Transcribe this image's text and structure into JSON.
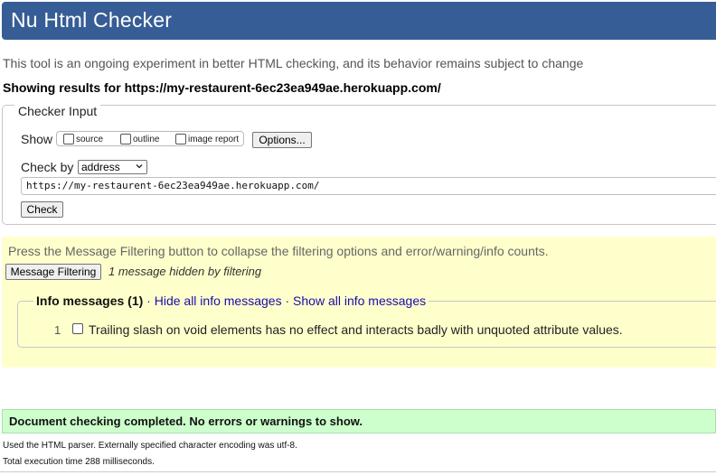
{
  "header": {
    "title": "Nu Html Checker"
  },
  "intro": "This tool is an ongoing experiment in better HTML checking, and its behavior remains subject to change",
  "showing": "Showing results for https://my-restaurent-6ec23ea949ae.herokuapp.com/",
  "checker_input": {
    "legend": "Checker Input",
    "show_label": "Show",
    "show_options": [
      {
        "label": "source",
        "checked": false
      },
      {
        "label": "outline",
        "checked": false
      },
      {
        "label": "image report",
        "checked": false
      }
    ],
    "options_button": "Options...",
    "check_by_label": "Check by",
    "check_by_value": "address",
    "url_value": "https://my-restaurent-6ec23ea949ae.herokuapp.com/",
    "check_button": "Check"
  },
  "filtering": {
    "hint": "Press the Message Filtering button to collapse the filtering options and error/warning/info counts.",
    "button": "Message Filtering",
    "hidden_note": "1 message hidden by filtering",
    "info": {
      "title": "Info messages (1)",
      "separator": "·",
      "hide_link": "Hide all info messages",
      "show_link": "Show all info messages",
      "messages": [
        {
          "number": "1",
          "text": "Trailing slash on void elements has no effect and interacts badly with unquoted attribute values.",
          "checked": false
        }
      ]
    }
  },
  "result": {
    "success": "Document checking completed. No errors or warnings to show.",
    "parser_note": "Used the HTML parser. Externally specified character encoding was utf-8.",
    "time_note": "Total execution time 288 milliseconds."
  },
  "colors": {
    "header_bg": "#365d95",
    "filter_bg": "#ffffcc",
    "success_bg": "#ccffcc",
    "link": "#1a0dab"
  }
}
